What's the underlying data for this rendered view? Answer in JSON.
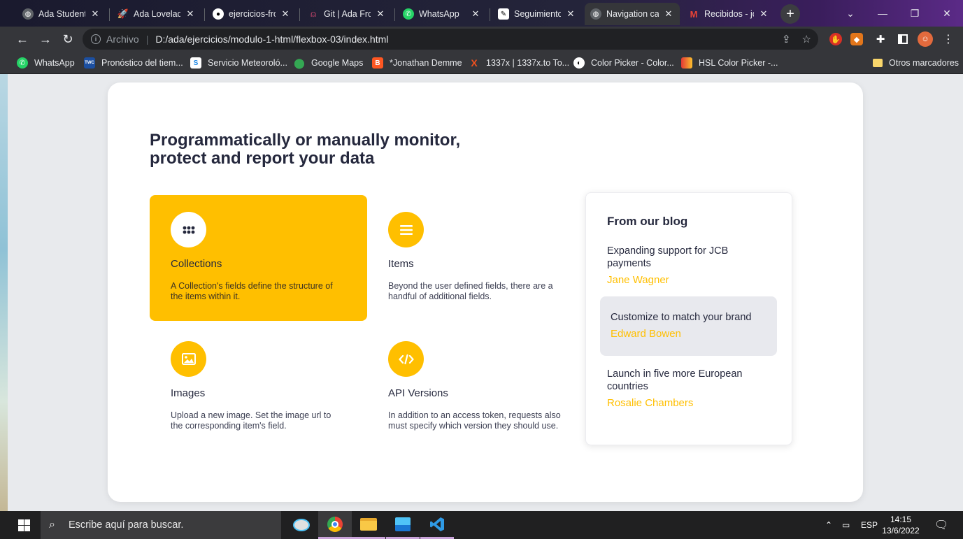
{
  "browser": {
    "tabs": [
      {
        "title": "Ada Students",
        "icon": "globe-icon"
      },
      {
        "title": "Ada Lovelace",
        "icon": "rocket-icon"
      },
      {
        "title": "ejercicios-fro",
        "icon": "github-icon"
      },
      {
        "title": "Git | Ada Fron",
        "icon": "ada-icon"
      },
      {
        "title": "WhatsApp",
        "icon": "whatsapp-icon"
      },
      {
        "title": "Seguimiento",
        "icon": "notion-icon"
      },
      {
        "title": "Navigation ca",
        "icon": "globe-icon",
        "active": true
      },
      {
        "title": "Recibidos - jo",
        "icon": "gmail-icon"
      }
    ],
    "address": {
      "scheme": "Archivo",
      "url": "D:/ada/ejercicios/modulo-1-html/flexbox-03/index.html"
    },
    "bookmarks": [
      {
        "label": "WhatsApp",
        "icon": "whatsapp-icon"
      },
      {
        "label": "Pronóstico del tiem...",
        "icon": "weather-icon"
      },
      {
        "label": "Servicio Meteoroló...",
        "icon": "meteo-icon"
      },
      {
        "label": "Google Maps",
        "icon": "maps-pin-icon"
      },
      {
        "label": "*Jonathan Demme",
        "icon": "blogger-icon"
      },
      {
        "label": "1337x | 1337x.to To...",
        "icon": "x-icon"
      },
      {
        "label": "Color Picker - Color...",
        "icon": "color-picker-icon"
      },
      {
        "label": "HSL Color Picker -...",
        "icon": "hsl-icon"
      }
    ],
    "other_bookmarks": "Otros marcadores"
  },
  "page": {
    "heading": "Programmatically or manually monitor, protect and report your data",
    "features": [
      {
        "title": "Collections",
        "description": "A Collection's fields define the structure of the items within it.",
        "icon": "grid-dots-icon",
        "highlighted": true
      },
      {
        "title": "Items",
        "description": "Beyond the user defined fields, there are a handful of additional fields.",
        "icon": "list-icon",
        "highlighted": false
      },
      {
        "title": "Images",
        "description": "Upload a new image. Set the image url to the corresponding item's field.",
        "icon": "image-icon",
        "highlighted": false
      },
      {
        "title": "API Versions",
        "description": "In addition to an access token, requests also must specify which version they should use.",
        "icon": "code-icon",
        "highlighted": false
      }
    ],
    "blog": {
      "title": "From our blog",
      "posts": [
        {
          "title": "Expanding support for JCB payments",
          "author": "Jane Wagner",
          "active": false
        },
        {
          "title": "Customize to match your brand",
          "author": "Edward Bowen",
          "active": true
        },
        {
          "title": "Launch in five more European countries",
          "author": "Rosalie Chambers",
          "active": false
        }
      ]
    },
    "colors": {
      "accent": "#ffbf00",
      "text": "#25283d",
      "card": "#ffffff",
      "background": "#e8eaed"
    }
  },
  "taskbar": {
    "search_placeholder": "Escribe aquí para buscar.",
    "language": "ESP",
    "time": "14:15",
    "date": "13/6/2022"
  }
}
